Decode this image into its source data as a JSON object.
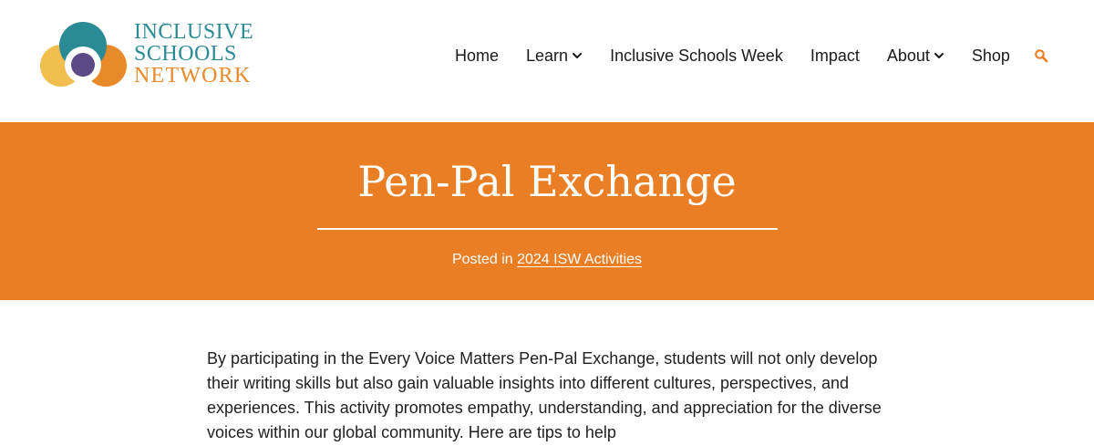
{
  "logo": {
    "line1": "INCLUSIVE",
    "line2": "SCHOOLS",
    "line3": "NETWORK",
    "tm": "™",
    "colors": {
      "teal": "#2b8b94",
      "orange": "#e98a2a",
      "yellow": "#f2be4f",
      "purple": "#5c4a86"
    }
  },
  "nav": {
    "items": [
      {
        "label": "Home"
      },
      {
        "label": "Learn",
        "has_dropdown": true
      },
      {
        "label": "Inclusive Schools Week"
      },
      {
        "label": "Impact"
      },
      {
        "label": "About",
        "has_dropdown": true
      },
      {
        "label": "Shop"
      }
    ],
    "search_icon": "search-icon",
    "search_color": "#e97e24"
  },
  "hero": {
    "title": "Pen-Pal Exchange",
    "posted_prefix": "Posted in",
    "category": "2024 ISW Activities",
    "background": "#e97e24"
  },
  "content": {
    "paragraph": "By participating in the Every Voice Matters Pen-Pal Exchange, students will not only develop their writing skills but also gain valuable insights into different cultures, perspectives, and experiences. This activity promotes empathy, understanding, and appreciation for the diverse voices within our global community. Here are tips to help"
  }
}
